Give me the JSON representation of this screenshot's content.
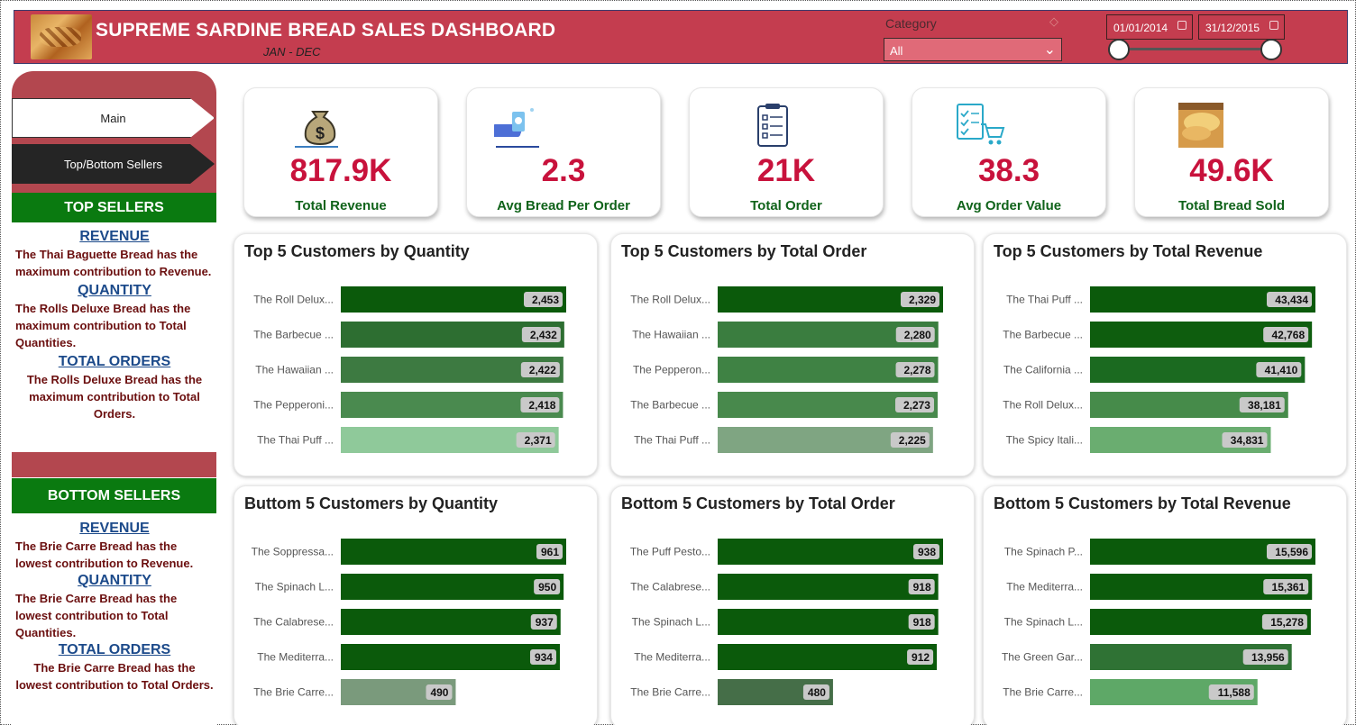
{
  "header": {
    "title": "SUPREME SARDINE BREAD SALES DASHBOARD",
    "subtitle": "JAN - DEC",
    "category_label": "Category",
    "category_value": "All",
    "date_start": "01/01/2014",
    "date_end": "31/12/2015"
  },
  "nav": {
    "main": "Main",
    "top_bottom": "Top/Bottom Sellers"
  },
  "top_sellers": {
    "heading": "TOP SELLERS",
    "revenue_title": "REVENUE",
    "revenue_text": "The Thai Baguette Bread  has the maximum contribution to Revenue.",
    "quantity_title": "QUANTITY",
    "quantity_text": "The Rolls Deluxe Bread has the maximum contribution to Total Quantities.",
    "orders_title": "TOTAL ORDERS",
    "orders_text": "The Rolls Deluxe Bread has the maximum contribution to Total Orders."
  },
  "bottom_sellers": {
    "heading": "BOTTOM SELLERS",
    "revenue_title": "REVENUE",
    "revenue_text": "The Brie Carre Bread has the lowest contribution to Revenue.",
    "quantity_title": "QUANTITY",
    "quantity_text": "The Brie Carre Bread has the lowest contribution to Total Quantities.",
    "orders_title": "TOTAL ORDERS",
    "orders_text": "The Brie Carre Bread has the lowest contribution to Total Orders."
  },
  "kpis": [
    {
      "value": "817.9K",
      "label": "Total Revenue",
      "icon": "money-bag-icon"
    },
    {
      "value": "2.3",
      "label": "Avg Bread Per Order",
      "icon": "payment-icon"
    },
    {
      "value": "21K",
      "label": "Total Order",
      "icon": "clipboard-icon"
    },
    {
      "value": "38.3",
      "label": "Avg Order Value",
      "icon": "checklist-cart-icon"
    },
    {
      "value": "49.6K",
      "label": "Total Bread Sold",
      "icon": "bread-photo-icon"
    }
  ],
  "colors": {
    "header_red": "#c43d4f",
    "kpi_value": "#c8123c",
    "kpi_label": "#10631a",
    "bar_darkest": "#0b5a0b",
    "bar_light": "#8fc99a"
  },
  "chart_data": [
    {
      "type": "bar",
      "title": "Top 5 Customers by Quantity",
      "categories": [
        "The Roll Delux...",
        "The Barbecue ...",
        "The Hawaiian ...",
        "The Pepperoni...",
        "The Thai Puff ..."
      ],
      "values": [
        2453,
        2432,
        2422,
        2418,
        2371
      ],
      "labels": [
        "2,453",
        "2,432",
        "2,422",
        "2,418",
        "2,371"
      ],
      "colors": [
        "#0b5a0b",
        "#2d6e31",
        "#3d7a41",
        "#4a8a4f",
        "#8fc99a"
      ]
    },
    {
      "type": "bar",
      "title": "Top 5 Customers by Total Order",
      "categories": [
        "The Roll Delux...",
        "The Hawaiian ...",
        "The Pepperon...",
        "The Barbecue ...",
        "The Thai Puff ..."
      ],
      "values": [
        2329,
        2280,
        2278,
        2273,
        2225
      ],
      "labels": [
        "2,329",
        "2,280",
        "2,278",
        "2,273",
        "2,225"
      ],
      "colors": [
        "#0b5a0b",
        "#3a7d3f",
        "#3f8244",
        "#48894c",
        "#7fa582"
      ]
    },
    {
      "type": "bar",
      "title": "Top 5 Customers by Total Revenue",
      "categories": [
        "The Thai Puff ...",
        "The Barbecue ...",
        "The California ...",
        "The Roll Delux...",
        "The Spicy Itali..."
      ],
      "values": [
        43434,
        42768,
        41410,
        38181,
        34831
      ],
      "labels": [
        "43,434",
        "42,768",
        "41,410",
        "38,181",
        "34,831"
      ],
      "colors": [
        "#0b5a0b",
        "#0e5d0e",
        "#1b6a20",
        "#468b4a",
        "#6aad70"
      ]
    },
    {
      "type": "bar",
      "title": "Buttom 5 Customers by Quantity",
      "categories": [
        "The Soppressa...",
        "The Spinach L...",
        "The Calabrese...",
        "The Mediterra...",
        "The Brie Carre..."
      ],
      "values": [
        961,
        950,
        937,
        934,
        490
      ],
      "labels": [
        "961",
        "950",
        "937",
        "934",
        "490"
      ],
      "colors": [
        "#0b5a0b",
        "#0b5a0b",
        "#0b5a0b",
        "#0b5a0b",
        "#7a9a7c"
      ]
    },
    {
      "type": "bar",
      "title": "Bottom 5 Customers by Total Order",
      "categories": [
        "The Puff Pesto...",
        "The Calabrese...",
        "The Spinach L...",
        "The Mediterra...",
        "The Brie Carre..."
      ],
      "values": [
        938,
        918,
        918,
        912,
        480
      ],
      "labels": [
        "938",
        "918",
        "918",
        "912",
        "480"
      ],
      "colors": [
        "#0b5a0b",
        "#0b5a0b",
        "#0b5a0b",
        "#0b5a0b",
        "#456e48"
      ]
    },
    {
      "type": "bar",
      "title": "Bottom 5 Customers by Total Revenue",
      "categories": [
        "The Spinach P...",
        "The Mediterra...",
        "The Spinach L...",
        "The Green Gar...",
        "The Brie Carre..."
      ],
      "values": [
        15596,
        15361,
        15278,
        13956,
        11588
      ],
      "labels": [
        "15,596",
        "15,361",
        "15,278",
        "13,956",
        "11,588"
      ],
      "colors": [
        "#0b5a0b",
        "#0b5a0b",
        "#0b5a0b",
        "#2f7234",
        "#5ea867"
      ]
    }
  ]
}
